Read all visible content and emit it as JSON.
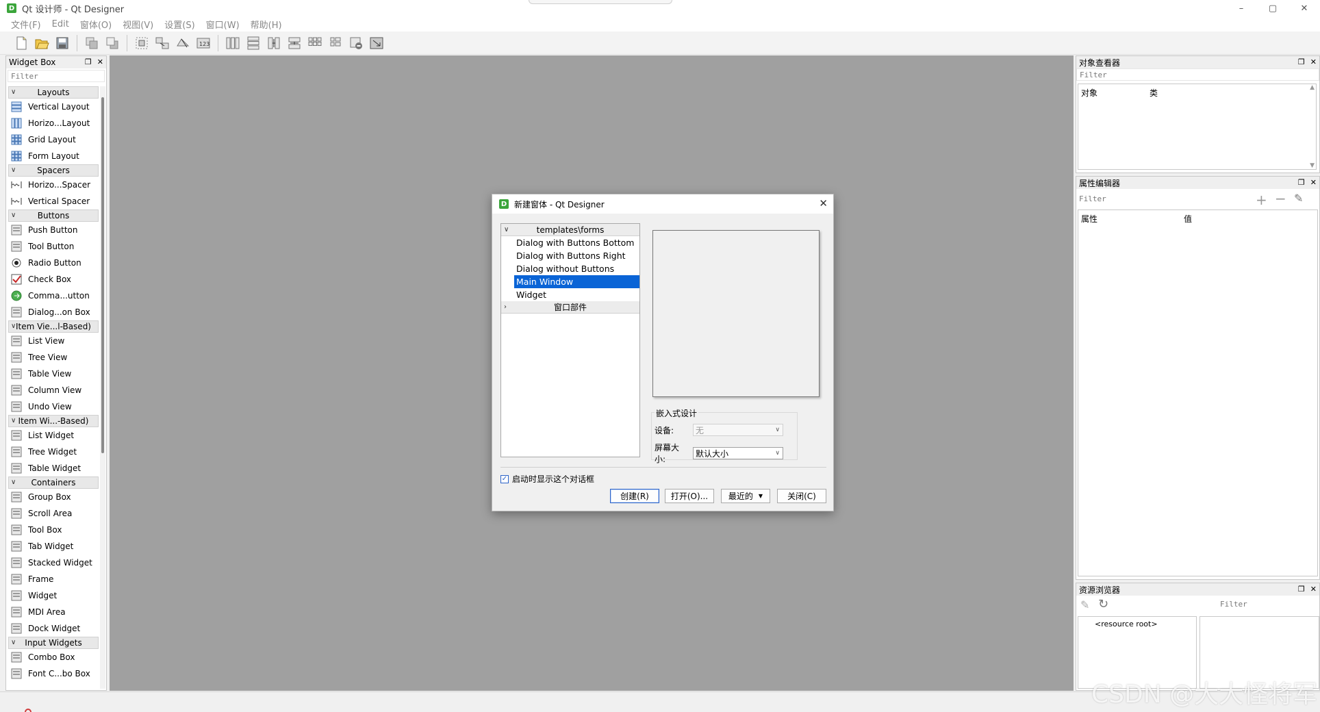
{
  "app": {
    "window_title": "Qt 设计师 - Qt Designer",
    "icon_letter": "D",
    "controls": {
      "minimize": "–",
      "maximize": "▢",
      "close": "✕"
    }
  },
  "menubar": [
    "文件(F)",
    "Edit",
    "窗体(O)",
    "视图(V)",
    "设置(S)",
    "窗口(W)",
    "帮助(H)"
  ],
  "toolbar": [
    {
      "name": "new-form-icon"
    },
    {
      "name": "open-form-icon"
    },
    {
      "name": "save-form-icon"
    },
    {
      "name": "send-to-back-icon"
    },
    {
      "name": "bring-to-front-icon"
    },
    {
      "name": "edit-widgets-icon"
    },
    {
      "name": "edit-signals-slots-icon"
    },
    {
      "name": "edit-buddies-icon"
    },
    {
      "name": "edit-tab-order-icon"
    },
    {
      "name": "lay-out-horizontally-icon"
    },
    {
      "name": "lay-out-vertically-icon"
    },
    {
      "name": "lay-out-horizontal-splitter-icon"
    },
    {
      "name": "lay-out-vertical-splitter-icon"
    },
    {
      "name": "lay-out-grid-icon"
    },
    {
      "name": "lay-out-form-icon"
    },
    {
      "name": "break-layout-icon"
    },
    {
      "name": "adjust-size-icon"
    }
  ],
  "widget_box": {
    "title": "Widget Box",
    "filter_placeholder": "Filter",
    "categories": [
      {
        "label": "Layouts",
        "items": [
          "Vertical Layout",
          "Horizo...Layout",
          "Grid Layout",
          "Form Layout"
        ]
      },
      {
        "label": "Spacers",
        "items": [
          "Horizo...Spacer",
          "Vertical Spacer"
        ]
      },
      {
        "label": "Buttons",
        "items": [
          "Push Button",
          "Tool Button",
          "Radio Button",
          "Check Box",
          "Comma...utton",
          "Dialog...on Box"
        ]
      },
      {
        "label": "Item Vie...l-Based)",
        "items": [
          "List View",
          "Tree View",
          "Table View",
          "Column View",
          "Undo View"
        ]
      },
      {
        "label": "Item Wi...-Based)",
        "items": [
          "List Widget",
          "Tree Widget",
          "Table Widget"
        ]
      },
      {
        "label": "Containers",
        "items": [
          "Group Box",
          "Scroll Area",
          "Tool Box",
          "Tab Widget",
          "Stacked Widget",
          "Frame",
          "Widget",
          "MDI Area",
          "Dock Widget"
        ]
      },
      {
        "label": "Input Widgets",
        "items": [
          "Combo Box",
          "Font C...bo Box"
        ]
      }
    ]
  },
  "object_inspector": {
    "title": "对象查看器",
    "filter_placeholder": "Filter",
    "col_object": "对象",
    "col_class": "类"
  },
  "property_editor": {
    "title": "属性编辑器",
    "filter_placeholder": "Filter",
    "col_property": "属性",
    "col_value": "值"
  },
  "resource_browser": {
    "title": "资源浏览器",
    "filter_placeholder": "Filter",
    "root": "<resource root>"
  },
  "new_form_dialog": {
    "title": "新建窗体 - Qt Designer",
    "group1": "templates\\forms",
    "templates": [
      "Dialog with Buttons Bottom",
      "Dialog with Buttons Right",
      "Dialog without Buttons",
      "Main Window",
      "Widget"
    ],
    "selected_template": "Main Window",
    "group2": "窗口部件",
    "embedded_legend": "嵌入式设计",
    "device_label": "设备:",
    "device_value": "无",
    "screen_size_label": "屏幕大小:",
    "screen_size_value": "默认大小",
    "show_on_startup_label": "启动时显示这个对话框",
    "show_on_startup_checked": true,
    "buttons": {
      "create": "创建(R)",
      "open": "打开(O)...",
      "recent": "最近的",
      "close": "关闭(C)"
    }
  },
  "watermark": "CSDN @大大怪将军"
}
